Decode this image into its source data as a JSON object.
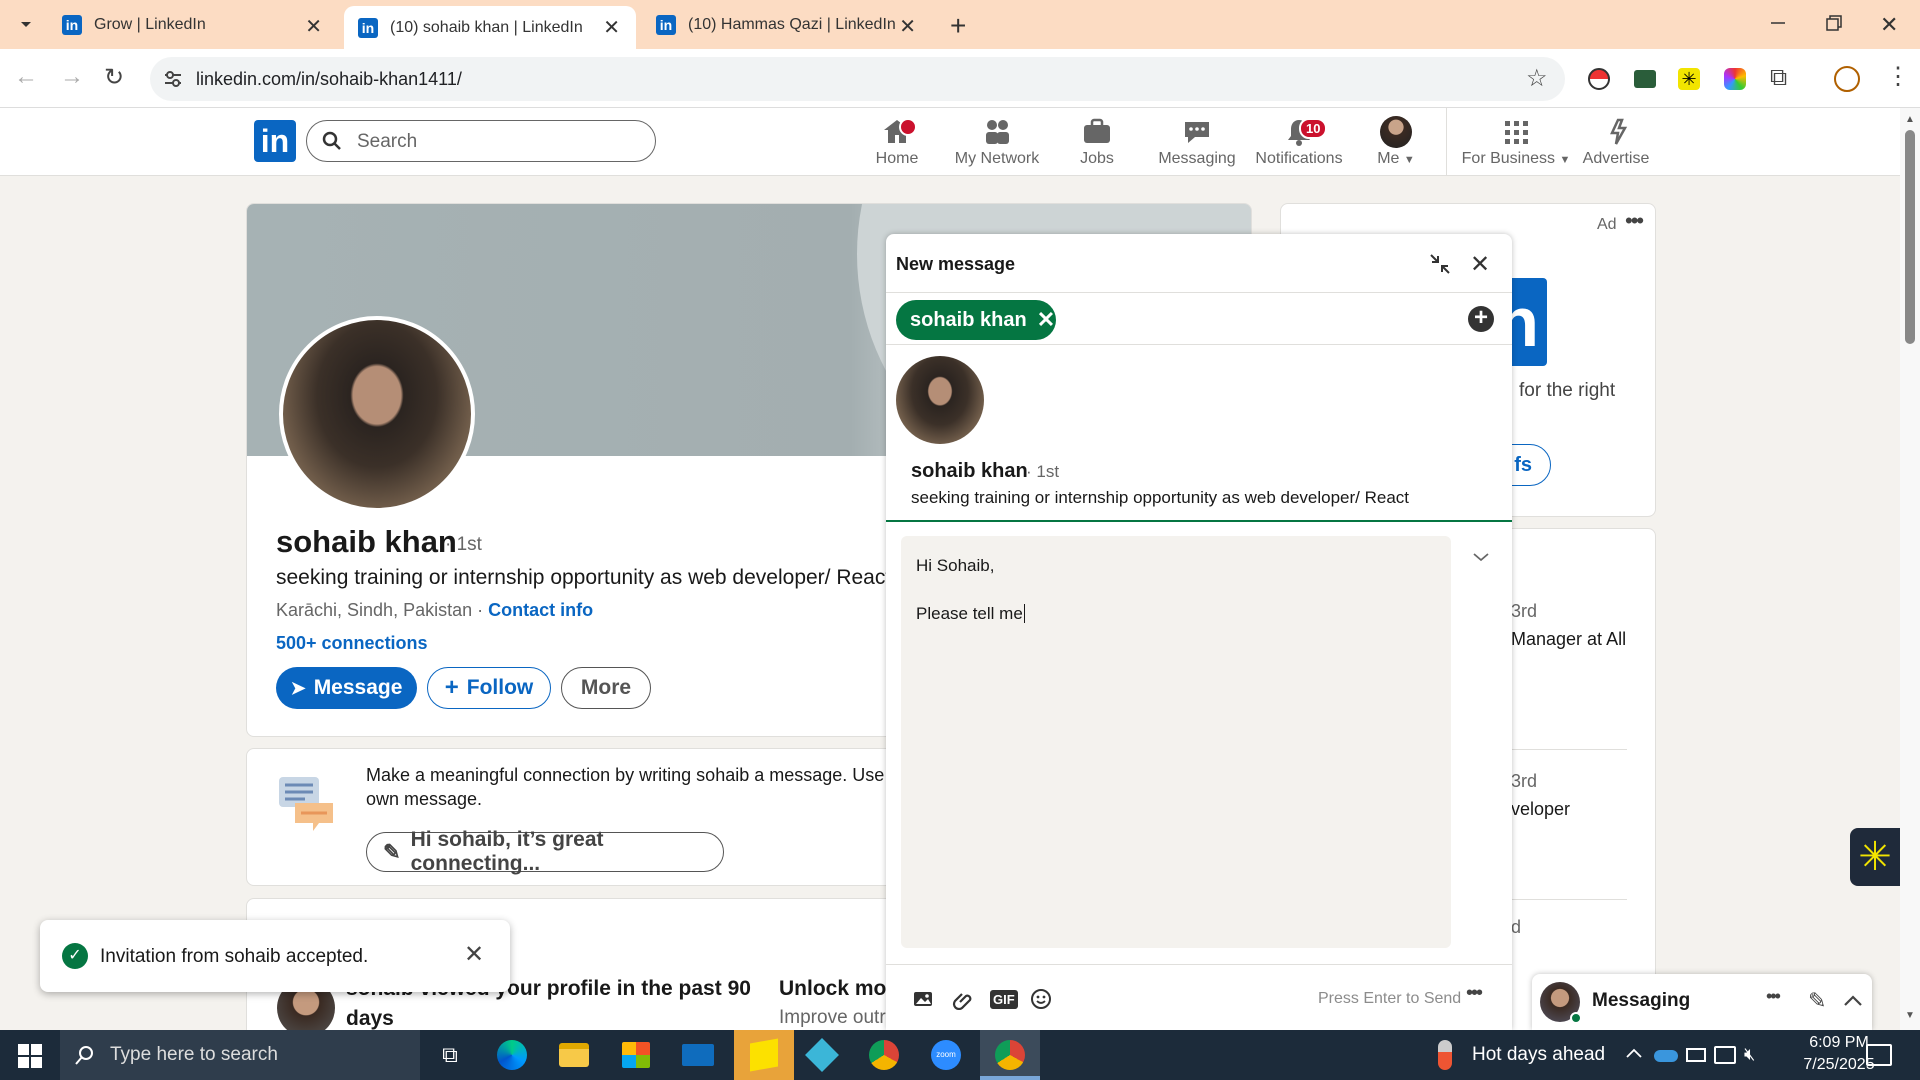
{
  "browser": {
    "tabs": [
      {
        "label": "Grow | LinkedIn"
      },
      {
        "label": "(10) sohaib khan | LinkedIn"
      },
      {
        "label": "(10) Hammas Qazi | LinkedIn"
      }
    ],
    "url": "linkedin.com/in/sohaib-khan1411/"
  },
  "nav": {
    "logo": "in",
    "search_placeholder": "Search",
    "items": [
      {
        "label": "Home"
      },
      {
        "label": "My Network"
      },
      {
        "label": "Jobs"
      },
      {
        "label": "Messaging"
      },
      {
        "label": "Notifications",
        "badge": "10"
      },
      {
        "label": "Me"
      },
      {
        "label": "For Business"
      },
      {
        "label": "Advertise"
      }
    ]
  },
  "profile": {
    "name": "sohaib khan",
    "degree": "· 1st",
    "headline": "seeking training or internship opportunity as web developer/ React",
    "location": "Karāchi, Sindh, Pakistan",
    "location_sep": "·",
    "contact_info": "Contact info",
    "connections": "500+ connections",
    "buttons": {
      "message": "Message",
      "follow": "Follow",
      "more": "More"
    }
  },
  "prompt_card": {
    "text_line1": "Make a meaningful connection by writing sohaib a message. Use a",
    "text_line2": "own message.",
    "suggestion": "Hi sohaib, it’s great connecting..."
  },
  "bottom_card": {
    "viewed_line1": "sohaib viewed your profile in the past 90",
    "viewed_line2": "days",
    "unlock": "Unlock more",
    "improve": "Improve outre"
  },
  "toast": {
    "text": "Invitation from sohaib accepted."
  },
  "right_rail": {
    "ad_label": "Ad",
    "ad_text": "for the right",
    "ad_button_partial": "fs",
    "logo_partial": "n",
    "person1_degree": "3rd",
    "person1_title": "Manager at All",
    "person2_degree": "3rd",
    "person2_title": "veloper",
    "person3_degree": "d"
  },
  "dialog": {
    "title": "New message",
    "recipient_chip": "sohaib khan",
    "recipient_name": "sohaib khan",
    "recipient_degree": "· 1st",
    "recipient_headline": "seeking training or internship opportunity as web developer/ React",
    "message_line1": "Hi Sohaib,",
    "message_line2": "Please tell me ",
    "send_hint": "Press Enter to Send",
    "gif": "GIF"
  },
  "messaging_bar": {
    "label": "Messaging"
  },
  "taskbar": {
    "search_placeholder": "Type here to search",
    "weather": "Hot days ahead",
    "time": "6:09 PM",
    "date": "7/25/2025"
  },
  "colors": {
    "linkedin_blue": "#0a66c2",
    "green_chip": "#057642",
    "tab_bar": "#fcdcc3",
    "notification_red": "#cb112d"
  }
}
